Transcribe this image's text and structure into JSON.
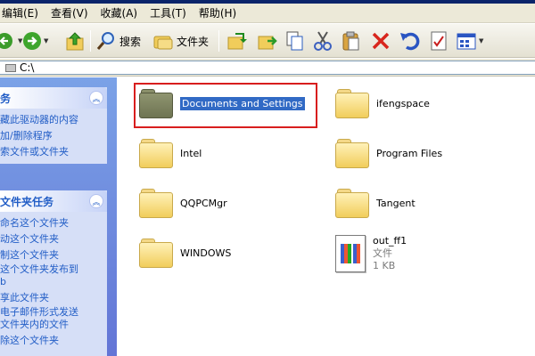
{
  "menu": [
    "编辑(E)",
    "查看(V)",
    "收藏(A)",
    "工具(T)",
    "帮助(H)"
  ],
  "toolbar": {
    "search_label": "搜索",
    "folders_label": "文件夹",
    "icons": [
      "back-arrow-icon",
      "forward-arrow-icon",
      "up-folder-icon",
      "search-icon",
      "folders-icon",
      "move-to-icon",
      "copy-to-icon",
      "copy-icon",
      "cut-icon",
      "paste-icon",
      "delete-icon",
      "undo-icon",
      "properties-icon",
      "views-icon"
    ]
  },
  "address": {
    "value": "C:\\"
  },
  "left_panel": {
    "system_tasks": {
      "title": "务",
      "items": [
        "藏此驱动器的内容",
        "加/删除程序",
        "索文件或文件夹"
      ]
    },
    "file_folder_tasks": {
      "title": "文件夹任务",
      "items": [
        "命名这个文件夹",
        "动这个文件夹",
        "制这个文件夹",
        "这个文件夹发布到",
        "b",
        "享此文件夹",
        "电子邮件形式发送",
        "文件夹内的文件",
        "除这个文件夹"
      ]
    }
  },
  "files": [
    {
      "name": "Documents and Settings",
      "type": "folder",
      "selected": true
    },
    {
      "name": "ifengspace",
      "type": "folder"
    },
    {
      "name": "Intel",
      "type": "folder"
    },
    {
      "name": "Program Files",
      "type": "folder"
    },
    {
      "name": "QQPCMgr",
      "type": "folder"
    },
    {
      "name": "Tangent",
      "type": "folder"
    },
    {
      "name": "WINDOWS",
      "type": "folder"
    },
    {
      "name": "out_ff1",
      "type": "file",
      "kind": "文件",
      "size": "1 KB"
    }
  ],
  "colors": {
    "selection": "#316ac5",
    "highlight_box": "#d81e1e",
    "task_link": "#215dc6"
  }
}
